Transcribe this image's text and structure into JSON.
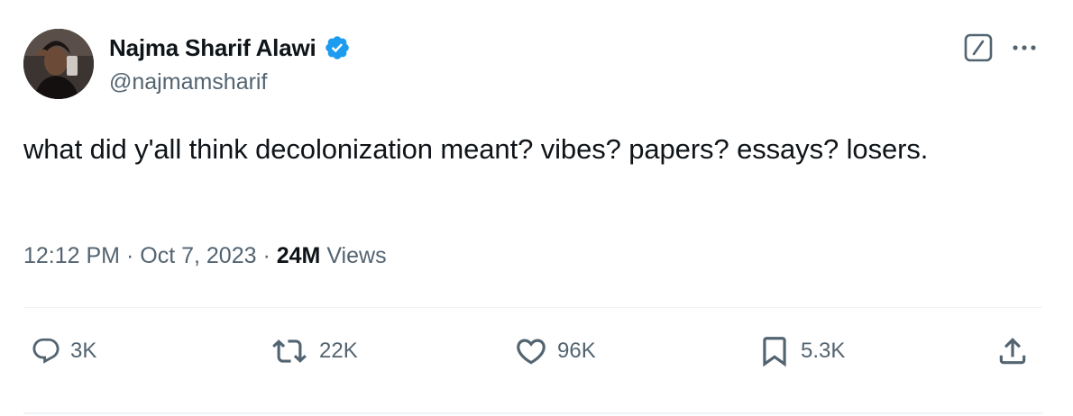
{
  "author": {
    "display_name": "Najma Sharif Alawi",
    "handle": "@najmamsharif",
    "verified": true,
    "verified_color": "#1d9bf0"
  },
  "tweet": {
    "text": "what did y'all think decolonization meant? vibes? papers? essays? losers.",
    "time": "12:12 PM",
    "date": "Oct 7, 2023",
    "separator": "·",
    "views_count": "24M",
    "views_label": "Views"
  },
  "actions": {
    "replies": "3K",
    "retweets": "22K",
    "likes": "96K",
    "bookmarks": "5.3K"
  },
  "icons": {
    "header": [
      "grok-icon",
      "more-icon"
    ],
    "actions": [
      "reply-icon",
      "retweet-icon",
      "like-icon",
      "bookmark-icon",
      "share-icon"
    ]
  },
  "colors": {
    "text_primary": "#0f1419",
    "text_secondary": "#536471",
    "accent": "#1d9bf0"
  }
}
